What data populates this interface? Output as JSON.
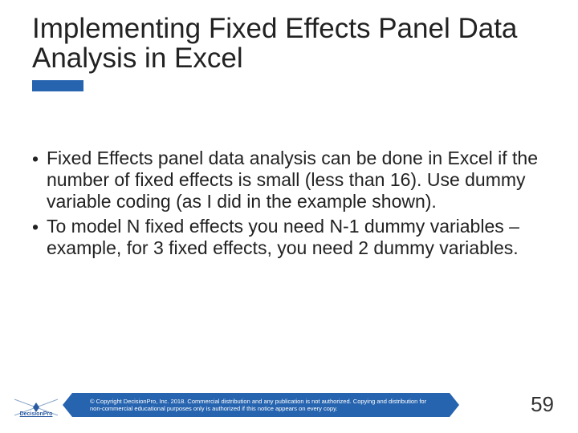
{
  "title": "Implementing Fixed Effects Panel Data Analysis in Excel",
  "bullets": [
    "Fixed Effects panel data analysis can be done in Excel if the number of fixed effects is small (less than 16). Use dummy variable coding (as I did in the example shown).",
    "To model N fixed effects you need N-1 dummy variables – example, for 3 fixed effects, you need 2 dummy variables."
  ],
  "logo_text": "DecisionPro",
  "footer_copyright": "© Copyright DecisionPro, Inc. 2018. Commercial distribution and any publication is not authorized. Copying and distribution for non-commercial educational purposes only is authorized if this notice appears on every copy.",
  "page_number": "59",
  "colors": {
    "accent": "#2664b0"
  }
}
